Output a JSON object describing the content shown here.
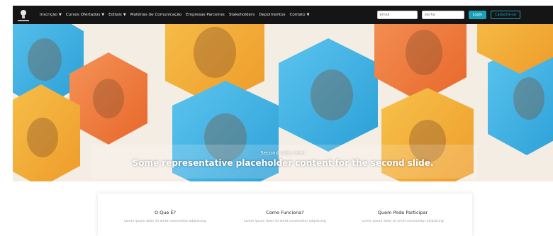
{
  "nav": {
    "items": [
      {
        "label": "Inscrição",
        "dropdown": true
      },
      {
        "label": "Cursos Ofertados",
        "dropdown": true
      },
      {
        "label": "Editais",
        "dropdown": true
      },
      {
        "label": "Matérias de Comunicação",
        "dropdown": false
      },
      {
        "label": "Empresas Parceiras",
        "dropdown": false
      },
      {
        "label": "Stakeholders",
        "dropdown": false
      },
      {
        "label": "Depoimentos",
        "dropdown": false
      },
      {
        "label": "Contato",
        "dropdown": true
      }
    ],
    "email_placeholder": "email",
    "senha_placeholder": "senha",
    "login_label": "Login",
    "cadastrar_label": "Cadastre-se",
    "accent_color": "#17a2b8"
  },
  "carousel": {
    "label": "Second slide label",
    "text": "Some representative placeholder content for the second slide.",
    "palette": [
      "#f0a52b",
      "#3fb3e6",
      "#f07a3a",
      "#f6c24a"
    ]
  },
  "info": {
    "columns": [
      {
        "title": "O Que É?",
        "text": "Lorem ipsum dolor sit amet consectetur adipisicing"
      },
      {
        "title": "Como Funciona?",
        "text": "Lorem ipsum dolor sit amet consectetur adipisicing"
      },
      {
        "title": "Quem Pode Participar",
        "text": "Lorem ipsum dolor sit amet consectetur adipisicing"
      }
    ]
  }
}
